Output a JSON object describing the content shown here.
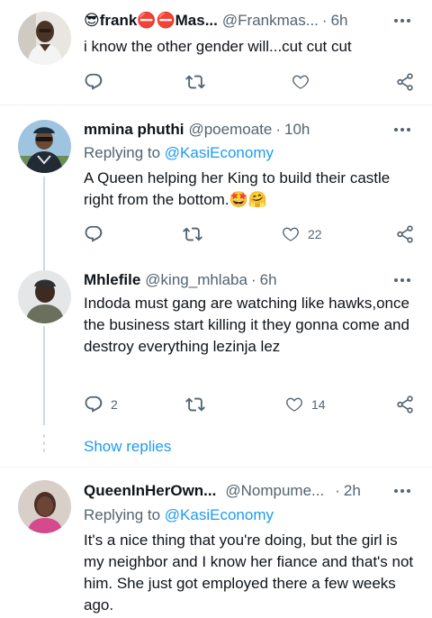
{
  "tweets": [
    {
      "name": "frank⛔⛔Mas...",
      "handle": "@Frankmas...",
      "time": "6h",
      "text": "i know the other gender will...cut cut cut",
      "replies": "",
      "retweets": "",
      "likes": ""
    },
    {
      "name": "mmina phuthi",
      "handle": "@poemoate",
      "time": "10h",
      "replying_label": "Replying to",
      "replying_to": "@KasiEconomy",
      "text": "A Queen helping her King to build their castle right from the bottom.🤩🤗",
      "replies": "",
      "retweets": "",
      "likes": "22"
    },
    {
      "name": "Mhlefile",
      "handle": "@king_mhlaba",
      "time": "6h",
      "text": "Indoda must gang are watching like hawks,once the business start killing it they gonna come and destroy everything lezinja lez",
      "replies": "2",
      "retweets": "",
      "likes": "14"
    },
    {
      "name": "QueenInHerOwn...",
      "handle": "@Nompume...",
      "time": "2h",
      "replying_label": "Replying to",
      "replying_to": "@KasiEconomy",
      "text": "It's a nice thing that you're doing, but the girl is my neighbor and I know her fiance and that's not him. She just got employed there a few weeks ago."
    }
  ],
  "show_replies_label": "Show replies",
  "separator": "·",
  "colors": {
    "accent": "#1d9bf0",
    "secondary_text": "#536471",
    "thread_line": "#cfd9de",
    "divider": "#eff3f4"
  },
  "icons": [
    "reply-icon",
    "retweet-icon",
    "like-icon",
    "share-icon",
    "more-icon"
  ]
}
